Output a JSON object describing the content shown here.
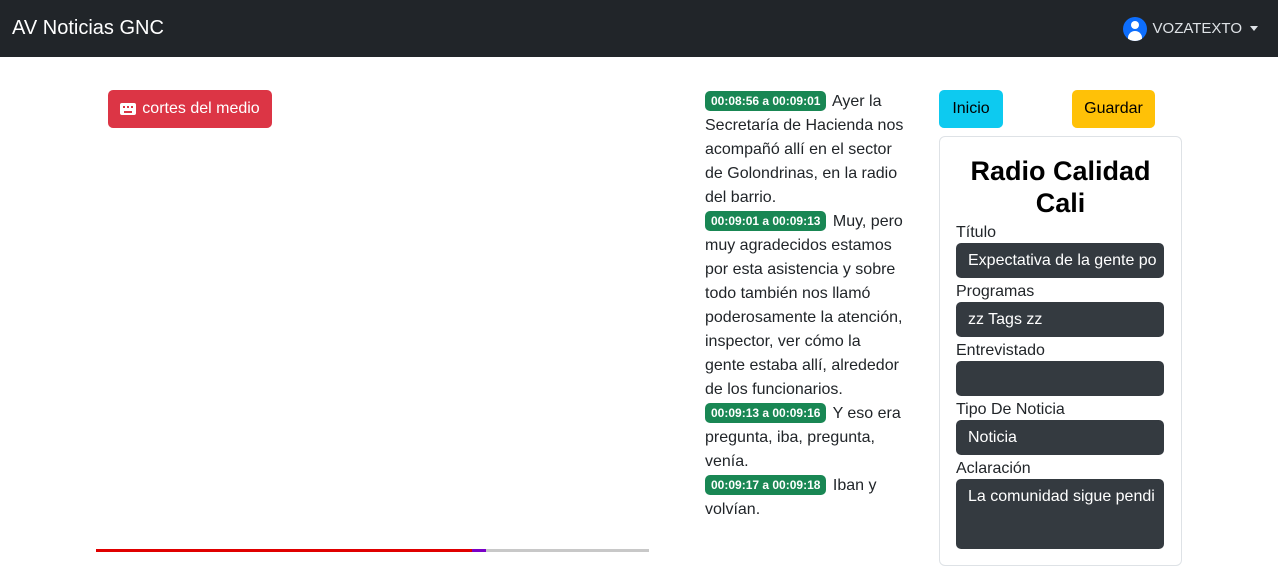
{
  "navbar": {
    "brand": "AV Noticias GNC",
    "user": "VOZATEXTO"
  },
  "media": {
    "cortes_label": "cortes del medio",
    "progress_fraction": 0.68
  },
  "transcript": [
    {
      "time": "00:08:56 a 00:09:01",
      "text": "Ayer la Secretaría de Hacienda nos acompañó allí en el sector de Golondrinas, en la radio del barrio."
    },
    {
      "time": "00:09:01 a 00:09:13",
      "text": "Muy, pero muy agradecidos estamos por esta asistencia y sobre todo también nos llamó poderosamente la atención, inspector, ver cómo la gente estaba allí, alrededor de los funcionarios."
    },
    {
      "time": "00:09:13 a 00:09:16",
      "text": "Y eso era pregunta, iba, pregunta, venía."
    },
    {
      "time": "00:09:17 a 00:09:18",
      "text": "Iban y volvían."
    }
  ],
  "actions": {
    "inicio": "Inicio",
    "guardar": "Guardar"
  },
  "form": {
    "station": "Radio Calidad Cali",
    "titulo_label": "Título",
    "titulo_value": "Expectativa de la gente po",
    "programas_label": "Programas",
    "programas_value": "zz Tags zz",
    "entrevistado_label": "Entrevistado",
    "entrevistado_value": "",
    "tipo_label": "Tipo De Noticia",
    "tipo_value": "Noticia",
    "aclaracion_label": "Aclaración",
    "aclaracion_value": "La comunidad sigue pendi"
  }
}
